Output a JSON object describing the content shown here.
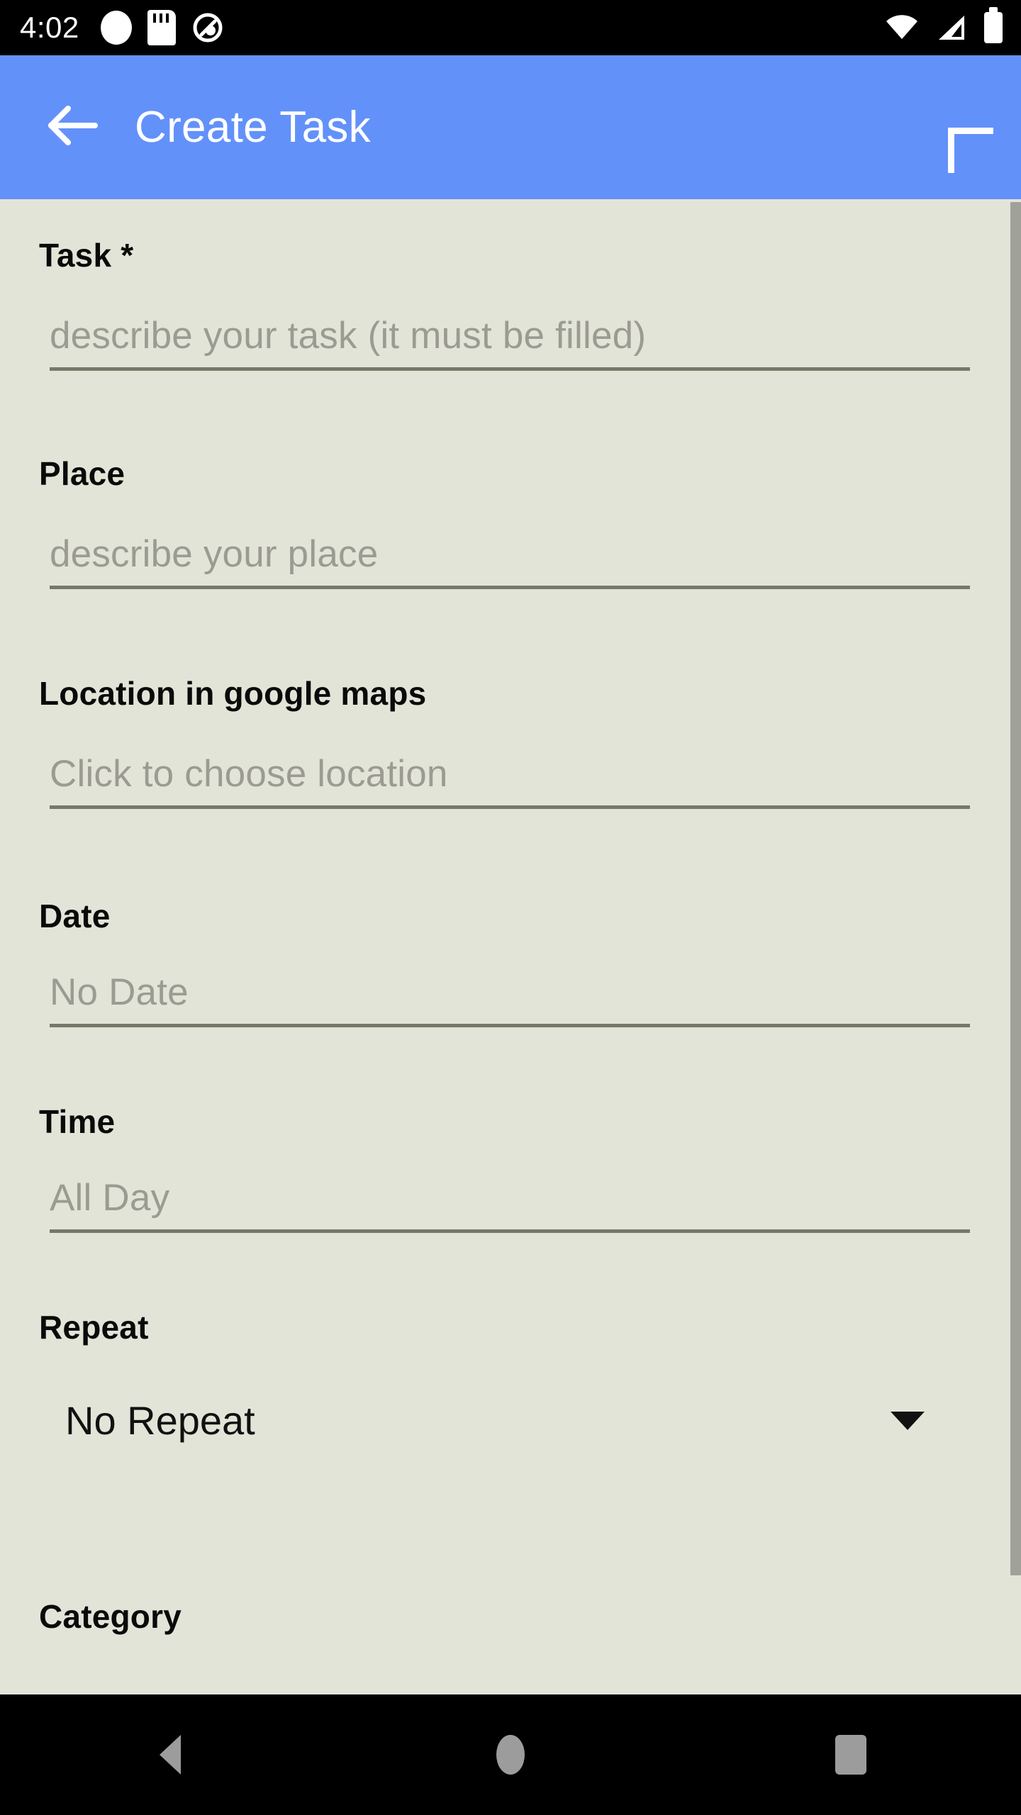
{
  "status_bar": {
    "time": "4:02",
    "left_icons": [
      "record-dot-icon",
      "sd-card-icon",
      "android-q-icon"
    ],
    "right_icons": [
      "wifi-icon",
      "cellular-signal-icon",
      "battery-icon"
    ],
    "background_color": "#000000",
    "foreground_color": "#FFFFFF"
  },
  "app_bar": {
    "back_icon": "arrow-left-icon",
    "title": "Create Task",
    "add_icon": "plus-icon",
    "background_color": "#6391FA",
    "text_color": "#FFFFFF"
  },
  "form": {
    "background_color": "#E3E4D8",
    "underline_color": "#787869",
    "placeholder_color": "#9B9B92",
    "label_color": "#0A0A0A",
    "fields": [
      {
        "id": "task",
        "label": "Task *",
        "type": "text",
        "value": "",
        "placeholder": "describe your task (it must be filled)",
        "required": true
      },
      {
        "id": "place",
        "label": "Place",
        "type": "text",
        "value": "",
        "placeholder": "describe your place",
        "required": false
      },
      {
        "id": "location",
        "label": "Location in google maps",
        "type": "picker",
        "value": "",
        "placeholder": "Click to choose location",
        "required": false
      },
      {
        "id": "date",
        "label": "Date",
        "type": "date",
        "value": "",
        "placeholder": "No Date",
        "required": false
      },
      {
        "id": "time",
        "label": "Time",
        "type": "time",
        "value": "",
        "placeholder": "All Day",
        "required": false
      }
    ],
    "repeat": {
      "label": "Repeat",
      "selected": "No Repeat",
      "caret_icon": "chevron-down-icon"
    },
    "category": {
      "label": "Category"
    }
  },
  "scrollbar": {
    "name": "vertical-scrollbar",
    "thumb_color": "#A0A299"
  },
  "nav_bar": {
    "background_color": "#000000",
    "icon_color": "#9C9C9C",
    "buttons": [
      {
        "id": "back",
        "icon": "triangle-back-icon"
      },
      {
        "id": "home",
        "icon": "circle-home-icon"
      },
      {
        "id": "recents",
        "icon": "square-recents-icon"
      }
    ]
  }
}
